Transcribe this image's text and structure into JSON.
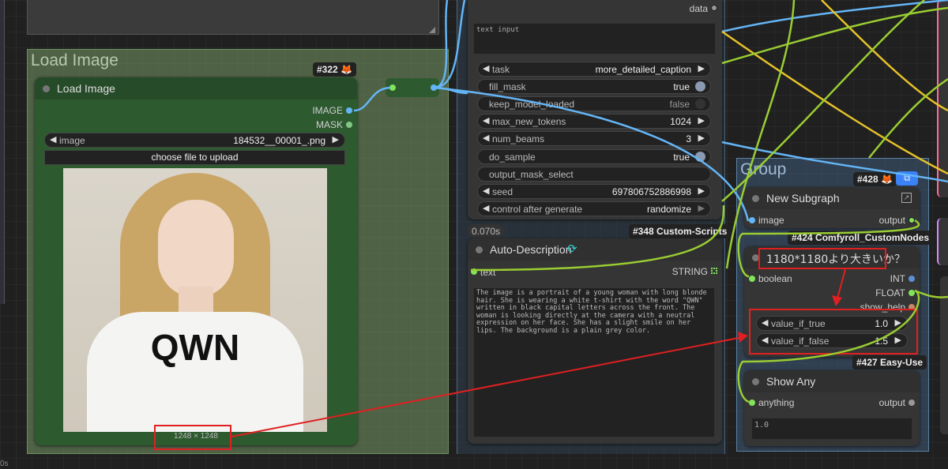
{
  "colors": {
    "canvas": "#202020",
    "image_wire": "#64B5F6",
    "string_wire": "#9ACD32",
    "float_wire": "#E6C229",
    "annotation_red": "#E02020",
    "mask_wire": "#81C784"
  },
  "load_image_group": {
    "title": "Load Image"
  },
  "load_image_node": {
    "badge": "#322 🦊",
    "title": "Load Image",
    "outputs": [
      "IMAGE",
      "MASK"
    ],
    "image_widget": {
      "label": "image",
      "value": "184532__00001_.png"
    },
    "upload_button": "choose file to upload",
    "preview_caption": "1248 × 1248",
    "preview_text": "QWN"
  },
  "florence_node": {
    "output_data": "data",
    "text_input_placeholder": "text input",
    "widgets": [
      {
        "name": "task",
        "value": "more_detailed_caption",
        "kind": "combo"
      },
      {
        "name": "fill_mask",
        "value": "true",
        "kind": "toggle_on"
      },
      {
        "name": "keep_model_loaded",
        "value": "false",
        "kind": "toggle_off"
      },
      {
        "name": "max_new_tokens",
        "value": "1024",
        "kind": "number"
      },
      {
        "name": "num_beams",
        "value": "3",
        "kind": "number"
      },
      {
        "name": "do_sample",
        "value": "true",
        "kind": "toggle_on"
      },
      {
        "name": "output_mask_select",
        "value": "",
        "kind": "text"
      },
      {
        "name": "seed",
        "value": "697806752886998",
        "kind": "number"
      },
      {
        "name": "control after generate",
        "value": "randomize",
        "kind": "combo"
      }
    ]
  },
  "auto_description_node": {
    "timing": "0.070s",
    "badge": "#348 Custom-Scripts",
    "title": "Auto-Description",
    "input": "text",
    "output": "STRING",
    "text": "The image is a portrait of a young woman with long blonde hair. She is wearing a white t-shirt with the word \"QWN\" written in black capital letters across the front. The woman is looking directly at the camera with a neutral expression on her face. She has a slight smile on her lips. The background is a plain grey color."
  },
  "group_right": {
    "title": "Group"
  },
  "new_subgraph_node": {
    "badge": "#428 🦊",
    "title": "New Subgraph",
    "input": "image",
    "output": "output"
  },
  "comfyroll_node": {
    "badge": "#424 Comfyroll_CustomNodes",
    "title": "1180*1180より大きいか？",
    "input": "boolean",
    "outputs": [
      "INT",
      "FLOAT",
      "show_help"
    ],
    "widgets": [
      {
        "name": "value_if_true",
        "value": "1.0"
      },
      {
        "name": "value_if_false",
        "value": "1.5"
      }
    ]
  },
  "show_any_node": {
    "badge": "#427 Easy-Use",
    "title": "Show Any",
    "input": "anything",
    "output": "output",
    "text": "1.0"
  },
  "edge_label": "0s"
}
